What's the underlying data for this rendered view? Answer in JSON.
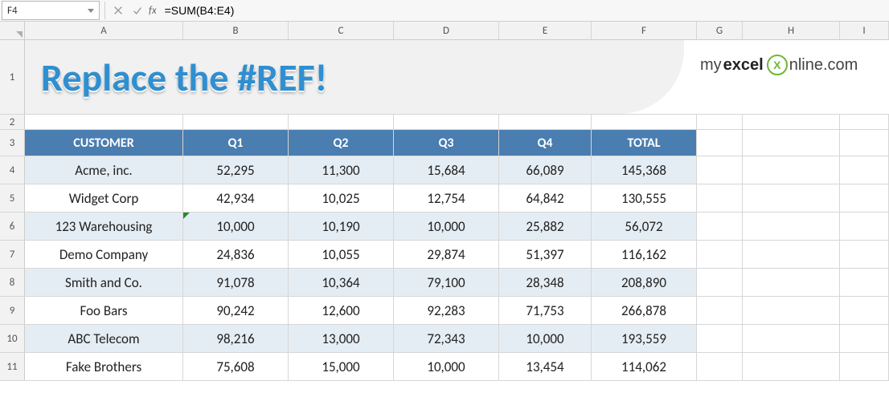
{
  "formulaBar": {
    "nameBox": "F4",
    "formula": "=SUM(B4:E4)"
  },
  "columns": [
    "A",
    "B",
    "C",
    "D",
    "E",
    "F",
    "G",
    "H",
    "I"
  ],
  "rowNumbers": [
    "1",
    "2",
    "3",
    "4",
    "5",
    "6",
    "7",
    "8",
    "9",
    "10",
    "11"
  ],
  "banner": "Replace the #REF!",
  "logo": {
    "my": "my",
    "excel": "excel",
    "mark": "X",
    "rest": "nline.com"
  },
  "table": {
    "headers": [
      "CUSTOMER",
      "Q1",
      "Q2",
      "Q3",
      "Q4",
      "TOTAL"
    ],
    "rows": [
      {
        "customer": "Acme, inc.",
        "q1": "52,295",
        "q2": "11,300",
        "q3": "15,684",
        "q4": "66,089",
        "total": "145,368"
      },
      {
        "customer": "Widget Corp",
        "q1": "42,934",
        "q2": "10,025",
        "q3": "12,754",
        "q4": "64,842",
        "total": "130,555"
      },
      {
        "customer": "123 Warehousing",
        "q1": "10,000",
        "q2": "10,190",
        "q3": "10,000",
        "q4": "25,882",
        "total": "56,072"
      },
      {
        "customer": "Demo Company",
        "q1": "24,836",
        "q2": "10,055",
        "q3": "29,874",
        "q4": "51,397",
        "total": "116,162"
      },
      {
        "customer": "Smith and Co.",
        "q1": "91,078",
        "q2": "10,364",
        "q3": "79,100",
        "q4": "28,348",
        "total": "208,890"
      },
      {
        "customer": "Foo Bars",
        "q1": "90,242",
        "q2": "12,600",
        "q3": "92,283",
        "q4": "71,753",
        "total": "266,878"
      },
      {
        "customer": "ABC Telecom",
        "q1": "98,216",
        "q2": "13,000",
        "q3": "72,343",
        "q4": "10,000",
        "total": "193,559"
      },
      {
        "customer": "Fake Brothers",
        "q1": "75,608",
        "q2": "15,000",
        "q3": "10,000",
        "q4": "13,454",
        "total": "114,062"
      }
    ]
  },
  "chart_data": {
    "type": "table",
    "title": "Replace the #REF!",
    "columns": [
      "CUSTOMER",
      "Q1",
      "Q2",
      "Q3",
      "Q4",
      "TOTAL"
    ],
    "rows": [
      [
        "Acme, inc.",
        52295,
        11300,
        15684,
        66089,
        145368
      ],
      [
        "Widget Corp",
        42934,
        10025,
        12754,
        64842,
        130555
      ],
      [
        "123 Warehousing",
        10000,
        10190,
        10000,
        25882,
        56072
      ],
      [
        "Demo Company",
        24836,
        10055,
        29874,
        51397,
        116162
      ],
      [
        "Smith and Co.",
        91078,
        10364,
        79100,
        28348,
        208890
      ],
      [
        "Foo Bars",
        90242,
        12600,
        92283,
        71753,
        266878
      ],
      [
        "ABC Telecom",
        98216,
        13000,
        72343,
        10000,
        193559
      ],
      [
        "Fake Brothers",
        75608,
        15000,
        10000,
        13454,
        114062
      ]
    ]
  }
}
